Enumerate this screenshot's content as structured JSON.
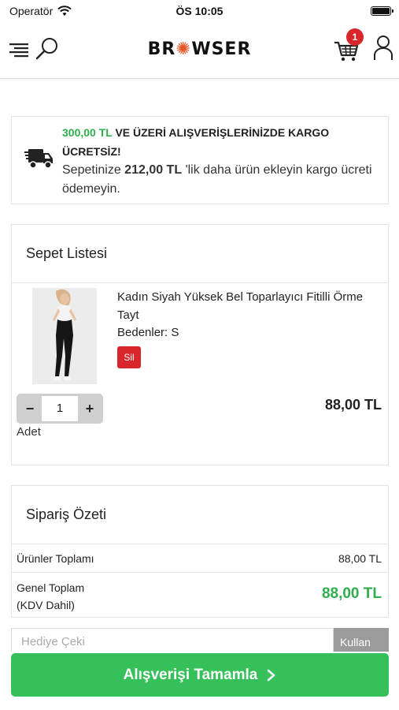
{
  "status_bar": {
    "carrier": "Operatör",
    "time": "ÖS 10:05"
  },
  "header": {
    "logo_left": "BR",
    "logo_right": "WSER",
    "cart_count": "1"
  },
  "shipping_notice": {
    "threshold": "300,00 TL",
    "headline_rest": "VE ÜZERİ ALIŞVERİŞLERİNİZDE KARGO ÜCRETSİZ!",
    "text_before": "Sepetinize",
    "remaining": "212,00 TL",
    "text_after": "'lik daha ürün ekleyin kargo ücreti ödemeyin."
  },
  "cart": {
    "title": "Sepet Listesi",
    "items": [
      {
        "name": "Kadın Siyah Yüksek Bel Toparlayıcı Fitilli Örme Tayt",
        "size": "Bedenler: S",
        "delete_label": "Sil",
        "quantity": "1",
        "minus": "−",
        "plus": "+",
        "quantity_label": "Adet",
        "price": "88,00 TL"
      }
    ]
  },
  "summary": {
    "title": "Sipariş Özeti",
    "products_total_label": "Ürünler Toplamı",
    "products_total_value": "88,00 TL",
    "grand_total_label_1": "Genel Toplam",
    "grand_total_label_2": "(KDV Dahil)",
    "grand_total_value": "88,00 TL"
  },
  "gift": {
    "placeholder": "Hediye Çeki",
    "button_label": "Kullan"
  },
  "checkout": {
    "label": "Alışverişi Tamamla"
  },
  "colors": {
    "green": "#2eae4c",
    "button_green": "#36c05a",
    "red": "#d9262c",
    "logo_accent": "#e8572a"
  }
}
